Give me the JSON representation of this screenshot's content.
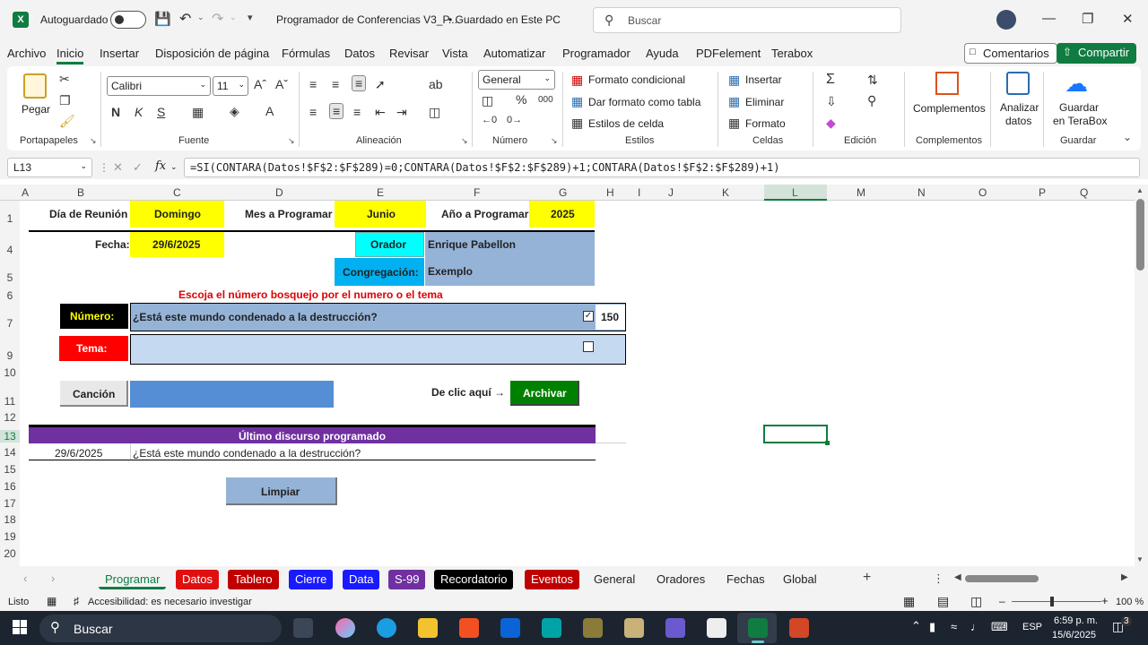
{
  "titlebar": {
    "autosave_label": "Autoguardado",
    "file_title": "Programador de Conferencias V3_P....",
    "save_status": "• Guardado en Este PC",
    "search_placeholder": "Buscar"
  },
  "menu": {
    "items": [
      "Archivo",
      "Inicio",
      "Insertar",
      "Disposición de página",
      "Fórmulas",
      "Datos",
      "Revisar",
      "Vista",
      "Automatizar",
      "Programador",
      "Ayuda",
      "PDFelement",
      "Terabox"
    ],
    "comments_label": "Comentarios",
    "share_label": "Compartir"
  },
  "ribbon": {
    "groups": [
      "Portapapeles",
      "Fuente",
      "Alineación",
      "Número",
      "Estilos",
      "Celdas",
      "Edición",
      "Complementos",
      "Guardar"
    ],
    "paste_label": "Pegar",
    "font_name": "Calibri",
    "font_size": "11",
    "number_format": "General",
    "styles": [
      "Formato condicional",
      "Dar formato como tabla",
      "Estilos de celda"
    ],
    "cells": [
      "Insertar",
      "Eliminar",
      "Formato"
    ],
    "complementos_label": "Complementos",
    "analyze_label_1": "Analizar",
    "analyze_label_2": "datos",
    "terabox_label_1": "Guardar",
    "terabox_label_2": "en TeraBox"
  },
  "formula_bar": {
    "name_box": "L13",
    "formula": "=SI(CONTARA(Datos!$F$2:$F$289)=0;CONTARA(Datos!$F$2:$F$289)+1;CONTARA(Datos!$F$2:$F$289)+1)"
  },
  "columns": [
    "A",
    "B",
    "C",
    "D",
    "E",
    "F",
    "G",
    "H",
    "I",
    "J",
    "K",
    "L",
    "M",
    "N",
    "O",
    "P",
    "Q"
  ],
  "rows": [
    "1",
    "4",
    "5",
    "6",
    "7",
    "9",
    "10",
    "11",
    "12",
    "13",
    "14",
    "15",
    "16",
    "17",
    "18",
    "19",
    "20"
  ],
  "sheet": {
    "dia_label": "Día de Reunión",
    "dia_value": "Domingo",
    "mes_label": "Mes a Programar",
    "mes_value": "Junio",
    "anio_label": "Año a Programar",
    "anio_value": "2025",
    "fecha_label": "Fecha:",
    "fecha_value": "29/6/2025",
    "orador_label": "Orador",
    "orador_value": "Enrique Pabellon",
    "congregacion_label": "Congregación:",
    "congregacion_value": "Exemplo",
    "instruccion": "Escoja el número bosquejo por el numero o el tema",
    "numero_label": "Número:",
    "numero_title": "¿Está este mundo condenado a la destrucción?",
    "numero_value": "150",
    "tema_label": "Tema:",
    "cancion_label": "Canción",
    "clic_label": "De clic aquí →",
    "archivar_label": "Archivar",
    "ultimo_header": "Último discurso programado",
    "ultimo_fecha": "29/6/2025",
    "ultimo_titulo": "¿Está este mundo condenado a la destrucción?",
    "limpiar_label": "Limpiar"
  },
  "tabs": [
    {
      "label": "Programar",
      "bg": "#f3f3f3",
      "color": "#107c41"
    },
    {
      "label": "Datos",
      "bg": "#e01010",
      "color": "#ffffff"
    },
    {
      "label": "Tablero",
      "bg": "#c00000",
      "color": "#ffffff"
    },
    {
      "label": "Cierre",
      "bg": "#1a1aff",
      "color": "#ffffff"
    },
    {
      "label": "Data",
      "bg": "#1a1aff",
      "color": "#ffffff"
    },
    {
      "label": "S-99",
      "bg": "#7030a0",
      "color": "#ffffff"
    },
    {
      "label": "Recordatorio",
      "bg": "#000000",
      "color": "#ffffff"
    },
    {
      "label": "Eventos",
      "bg": "#c00000",
      "color": "#ffffff"
    },
    {
      "label": "General",
      "bg": "#f3f3f3",
      "color": "#222222"
    },
    {
      "label": "Oradores",
      "bg": "#f3f3f3",
      "color": "#222222"
    },
    {
      "label": "Fechas",
      "bg": "#f3f3f3",
      "color": "#222222"
    },
    {
      "label": "Global",
      "bg": "#f3f3f3",
      "color": "#222222"
    }
  ],
  "status": {
    "ready": "Listo",
    "accessibility": "Accesibilidad: es necesario investigar",
    "zoom": "100 %"
  },
  "taskbar": {
    "search": "Buscar",
    "lang": "ESP",
    "time": "6:59 p. m.",
    "date": "15/6/2025",
    "badge": "3"
  }
}
